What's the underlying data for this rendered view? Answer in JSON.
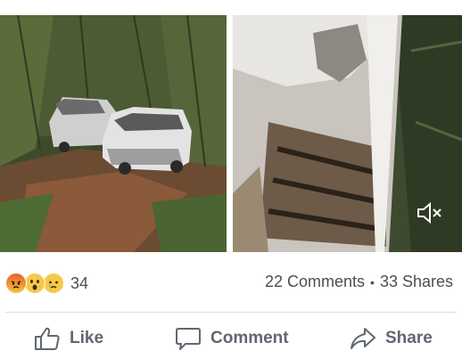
{
  "post": {
    "photos": [
      {
        "name": "photo-burned-cars-wide"
      },
      {
        "name": "photo-burned-car-closeup"
      }
    ],
    "video_icon": "speaker-muted-icon"
  },
  "stats": {
    "reactions": [
      "angry-reaction-icon",
      "wow-reaction-icon",
      "sad-reaction-icon"
    ],
    "reaction_count": "34",
    "comments": "22 Comments",
    "separator": "•",
    "shares": "33 Shares"
  },
  "actions": {
    "like": {
      "label": "Like",
      "icon": "thumbs-up-icon"
    },
    "comment": {
      "label": "Comment",
      "icon": "speech-bubble-icon"
    },
    "share": {
      "label": "Share",
      "icon": "share-arrow-icon"
    }
  },
  "colors": {
    "text_secondary": "#606770",
    "divider": "#dadde1"
  }
}
